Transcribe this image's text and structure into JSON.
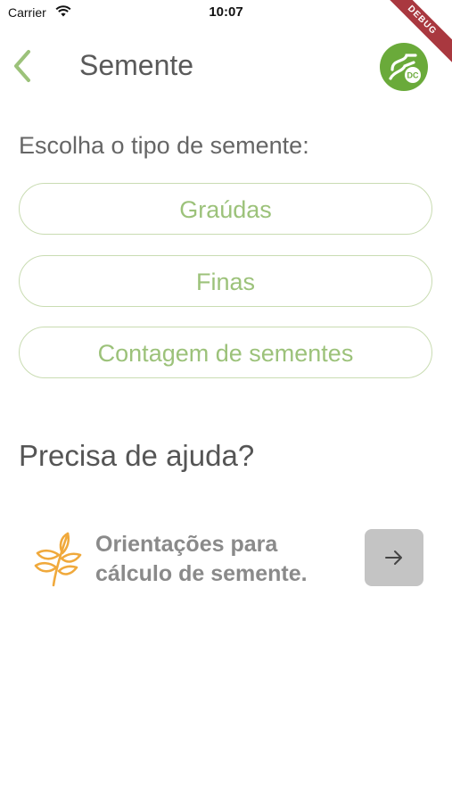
{
  "status_bar": {
    "carrier": "Carrier",
    "time": "10:07",
    "debug_label": "DEBUG"
  },
  "header": {
    "title": "Semente",
    "back_icon": "chevron-left-icon",
    "logo_icon": "dc-logo",
    "logo_text": "DC"
  },
  "prompt": "Escolha o tipo de semente:",
  "options": [
    {
      "label": "Graúdas"
    },
    {
      "label": "Finas"
    },
    {
      "label": "Contagem de sementes"
    }
  ],
  "help": {
    "heading": "Precisa de ajuda?",
    "card": {
      "icon": "plant-icon",
      "line1": "Orientações para",
      "line2": "cálculo de semente.",
      "button_icon": "arrow-right-icon"
    }
  },
  "colors": {
    "accent_green": "#9cc27a",
    "border_green": "#c9dcb2",
    "logo_green": "#6aaa3a",
    "plant_orange": "#f0a93c",
    "button_gray": "#c4c4c4"
  }
}
